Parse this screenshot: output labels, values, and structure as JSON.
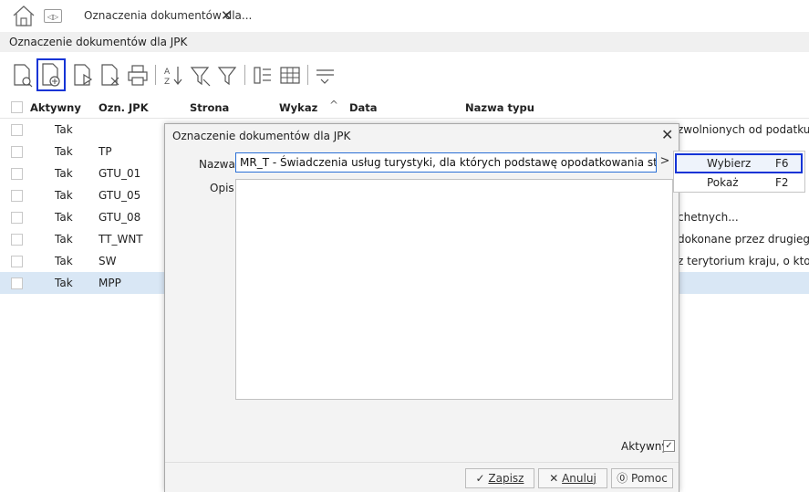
{
  "tabbar": {
    "tab_title": "Oznaczenia dokumentów dla...",
    "close_glyph": "✕"
  },
  "subheader": {
    "title": "Oznaczenie dokumentów dla JPK"
  },
  "toolbar": {
    "icons": [
      "preview-icon",
      "add-document-icon",
      "edit-document-icon",
      "delete-document-icon",
      "print-icon",
      "sort-az-icon",
      "filter-clear-icon",
      "filter-icon",
      "group-icon",
      "columns-icon",
      "more-menu-icon"
    ]
  },
  "grid": {
    "columns": {
      "aktywny": "Aktywny",
      "ozn": "Ozn. JPK",
      "strona": "Strona",
      "wykaz": "Wykaz",
      "data": "Data",
      "nazwa": "Nazwa typu"
    },
    "rows": [
      {
        "aktywny": "Tak",
        "ozn": "",
        "nazwa": "zwolnionych od podatku"
      },
      {
        "aktywny": "Tak",
        "ozn": "TP",
        "nazwa": ""
      },
      {
        "aktywny": "Tak",
        "ozn": "GTU_01",
        "nazwa": ""
      },
      {
        "aktywny": "Tak",
        "ozn": "GTU_05",
        "nazwa": ""
      },
      {
        "aktywny": "Tak",
        "ozn": "GTU_08",
        "nazwa": "chetnych..."
      },
      {
        "aktywny": "Tak",
        "ozn": "TT_WNT",
        "nazwa": "dokonane przez drugiego"
      },
      {
        "aktywny": "Tak",
        "ozn": "SW",
        "nazwa": "z terytorium kraju, o kto"
      },
      {
        "aktywny": "Tak",
        "ozn": "MPP",
        "nazwa": ""
      }
    ]
  },
  "dialog": {
    "title": "Oznaczenie dokumentów dla JPK",
    "nazwa_label": "Nazwa",
    "nazwa_value": "MR_T - Świadczenia usług turystyki, dla których podstawę opodatkowania stanowi zg",
    "opis_label": "Opis",
    "opis_value": "",
    "aktywny_label": "Aktywny",
    "aktywny_checked": true,
    "buttons": {
      "zapisz": "Zapisz",
      "anuluj": "Anuluj",
      "pomoc": "Pomoc"
    }
  },
  "dropdown": {
    "items": [
      {
        "label": "Wybierz",
        "shortcut": "F6"
      },
      {
        "label": "Pokaż",
        "shortcut": "F2"
      }
    ]
  },
  "colors": {
    "accent": "#1434d6",
    "selected_row": "#d9e7f5"
  }
}
